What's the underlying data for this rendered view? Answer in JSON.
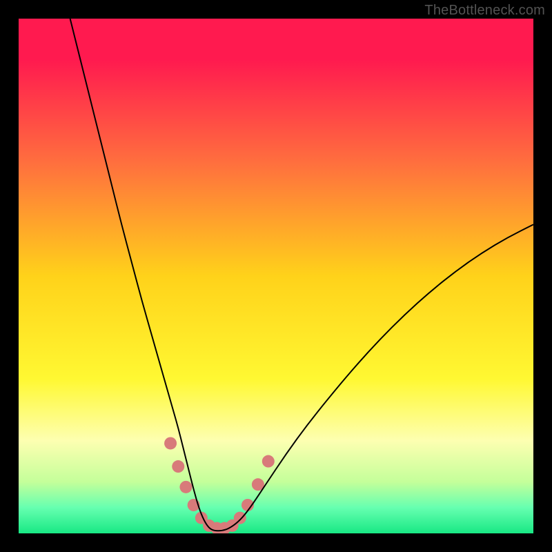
{
  "watermark": "TheBottleneck.com",
  "chart_data": {
    "type": "line",
    "title": "",
    "xlabel": "",
    "ylabel": "",
    "xlim": [
      0,
      100
    ],
    "ylim": [
      0,
      100
    ],
    "background_gradient": {
      "stops": [
        {
          "offset": 0.0,
          "color": "#ff1a4f"
        },
        {
          "offset": 0.08,
          "color": "#ff1a4f"
        },
        {
          "offset": 0.28,
          "color": "#ff6f3e"
        },
        {
          "offset": 0.5,
          "color": "#ffd21a"
        },
        {
          "offset": 0.7,
          "color": "#fff832"
        },
        {
          "offset": 0.82,
          "color": "#fdffb1"
        },
        {
          "offset": 0.9,
          "color": "#c4ff9a"
        },
        {
          "offset": 0.95,
          "color": "#66ffb0"
        },
        {
          "offset": 1.0,
          "color": "#18e884"
        }
      ]
    },
    "series": [
      {
        "name": "bottleneck-curve",
        "color": "#000000",
        "stroke_width": 2.0,
        "x": [
          10.0,
          12.0,
          14.0,
          16.0,
          18.0,
          20.0,
          22.0,
          24.0,
          26.0,
          28.0,
          30.0,
          31.0,
          32.0,
          33.0,
          34.0,
          35.0,
          36.0,
          37.0,
          38.0,
          39.5,
          41.0,
          43.0,
          45.0,
          48.0,
          52.0,
          56.0,
          60.0,
          65.0,
          70.0,
          75.0,
          80.0,
          85.0,
          90.0,
          95.0,
          100.0
        ],
        "y": [
          100.0,
          92.0,
          84.0,
          76.0,
          68.0,
          60.0,
          52.5,
          45.0,
          38.0,
          31.0,
          24.0,
          20.5,
          16.5,
          12.5,
          8.5,
          5.0,
          2.5,
          1.0,
          0.5,
          0.5,
          1.0,
          2.5,
          5.0,
          9.5,
          15.5,
          21.0,
          26.0,
          32.0,
          37.5,
          42.5,
          47.0,
          51.0,
          54.5,
          57.5,
          60.0
        ]
      },
      {
        "name": "bottom-marker-dots",
        "color": "#d87a7a",
        "marker_radius": 9,
        "x": [
          29.5,
          31.0,
          32.5,
          34.0,
          35.5,
          37.0,
          38.5,
          40.0,
          41.5,
          43.0,
          44.5,
          46.5,
          48.5
        ],
        "y": [
          17.5,
          13.0,
          9.0,
          5.5,
          3.0,
          1.5,
          1.0,
          1.0,
          1.5,
          3.0,
          5.5,
          9.5,
          14.0
        ]
      }
    ]
  }
}
